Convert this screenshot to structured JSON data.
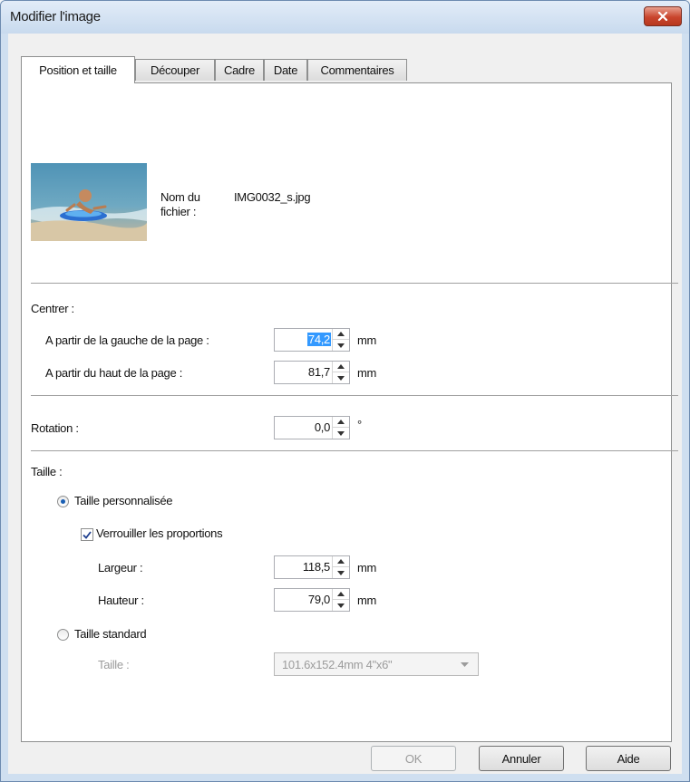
{
  "window": {
    "title": "Modifier l'image"
  },
  "tabs": [
    {
      "label": "Position et taille",
      "active": true
    },
    {
      "label": "Découper"
    },
    {
      "label": "Cadre"
    },
    {
      "label": "Date"
    },
    {
      "label": "Commentaires"
    }
  ],
  "image": {
    "filename_label": "Nom du\nfichier :",
    "filename": "IMG0032_s.jpg"
  },
  "center": {
    "heading": "Centrer :",
    "from_left_label": "A partir de la gauche de la page :",
    "from_left_value": "74,2",
    "from_top_label": "A partir du haut de la page :",
    "from_top_value": "81,7",
    "unit": "mm"
  },
  "rotation": {
    "label": "Rotation :",
    "value": "0,0",
    "unit": "°"
  },
  "size": {
    "heading": "Taille :",
    "custom_label": "Taille personnalisée",
    "custom_selected": true,
    "lock_label": "Verrouiller les proportions",
    "lock_checked": true,
    "width_label": "Largeur :",
    "width_value": "118,5",
    "height_label": "Hauteur :",
    "height_value": "79,0",
    "unit": "mm",
    "standard_label": "Taille standard",
    "standard_size_label": "Taille :",
    "standard_size_value": "101.6x152.4mm 4\"x6\""
  },
  "buttons": {
    "ok": "OK",
    "cancel": "Annuler",
    "help": "Aide"
  },
  "colors": {
    "title_bar": "#c8daee",
    "close_button": "#c9452d",
    "selection": "#3399ff"
  },
  "icons": {
    "close": "close-icon",
    "spin_up": "arrow-up-icon",
    "spin_down": "arrow-down-icon",
    "dropdown": "chevron-down-icon"
  }
}
